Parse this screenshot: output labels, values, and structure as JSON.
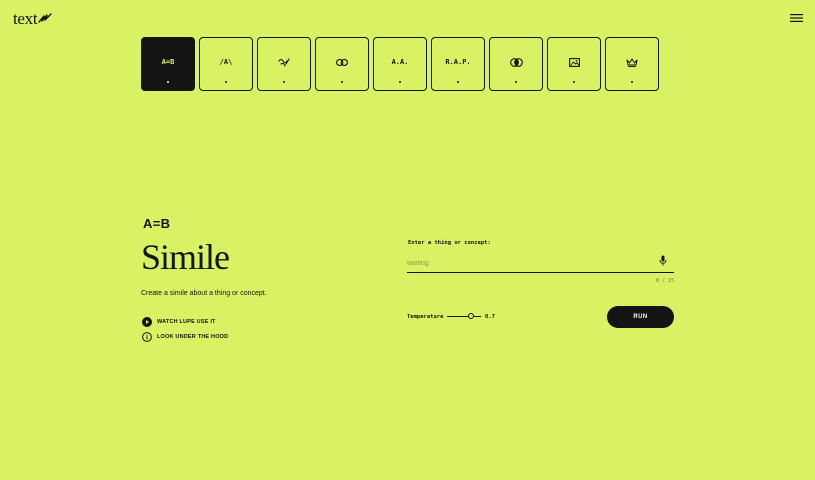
{
  "header": {
    "logo_text": "text",
    "menu_icon": "hamburger-menu-icon"
  },
  "tools": [
    {
      "id": "simile",
      "glyph": "A=B",
      "icon": "a-equals-b-icon",
      "active": true
    },
    {
      "id": "unexpected-connections",
      "glyph": "/A\\",
      "icon": "pyramid-icon",
      "active": false
    },
    {
      "id": "poem",
      "glyph": "",
      "icon": "squiggle-icon",
      "active": false
    },
    {
      "id": "chain",
      "glyph": "",
      "icon": "link-icon",
      "active": false
    },
    {
      "id": "alliteration",
      "glyph": "A.A.",
      "icon": "alliteration-icon",
      "active": false
    },
    {
      "id": "acronym",
      "glyph": "R.A.P.",
      "icon": "acronym-icon",
      "active": false
    },
    {
      "id": "both-or-neither",
      "glyph": "",
      "icon": "venn-icon",
      "active": false
    },
    {
      "id": "scene",
      "glyph": "",
      "icon": "image-icon",
      "active": false
    },
    {
      "id": "reimagine",
      "glyph": "",
      "icon": "crown-icon",
      "active": false
    }
  ],
  "main": {
    "eyebrow": "A=B",
    "title": "Simile",
    "description": "Create a simile about a thing or concept.",
    "links": [
      {
        "label": "WATCH LUPE USE IT",
        "icon": "play-circle-icon"
      },
      {
        "label": "LOOK UNDER THE HOOD",
        "icon": "info-circle-icon"
      }
    ]
  },
  "form": {
    "label": "Enter a thing or concept:",
    "placeholder": "waiting",
    "value": "",
    "counter": "0 / 15",
    "temperature_label": "Temperature",
    "temperature_value": "0.7",
    "temperature_fraction": 0.7,
    "run_label": "RUN"
  },
  "colors": {
    "background": "#d9f264",
    "ink": "#141414"
  }
}
